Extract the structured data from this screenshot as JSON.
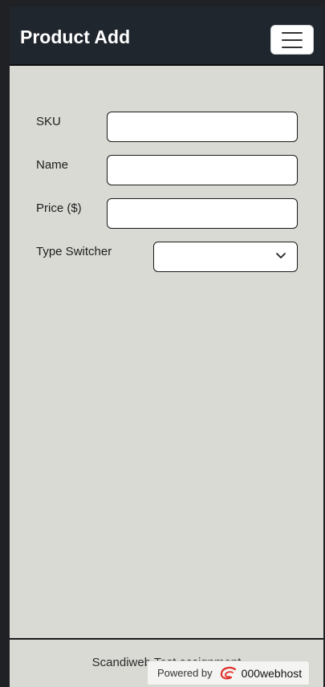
{
  "navbar": {
    "title": "Product Add",
    "toggle_icon": "hamburger-menu-icon"
  },
  "form": {
    "sku": {
      "label": "SKU",
      "value": "",
      "placeholder": ""
    },
    "name": {
      "label": "Name",
      "value": "",
      "placeholder": ""
    },
    "price": {
      "label": "Price ($)",
      "value": "",
      "placeholder": ""
    },
    "type_switcher": {
      "label": "Type Switcher",
      "selected": "",
      "icon": "chevron-down-icon"
    }
  },
  "footer": {
    "text": "Scandiweb Test assignment",
    "badge": {
      "powered_by": "Powered by",
      "brand": "000webhost",
      "logo_color": "#e0302a"
    }
  },
  "colors": {
    "navbar_bg": "#20262d",
    "page_bg": "#dadad5",
    "frame_bg": "#202124"
  }
}
